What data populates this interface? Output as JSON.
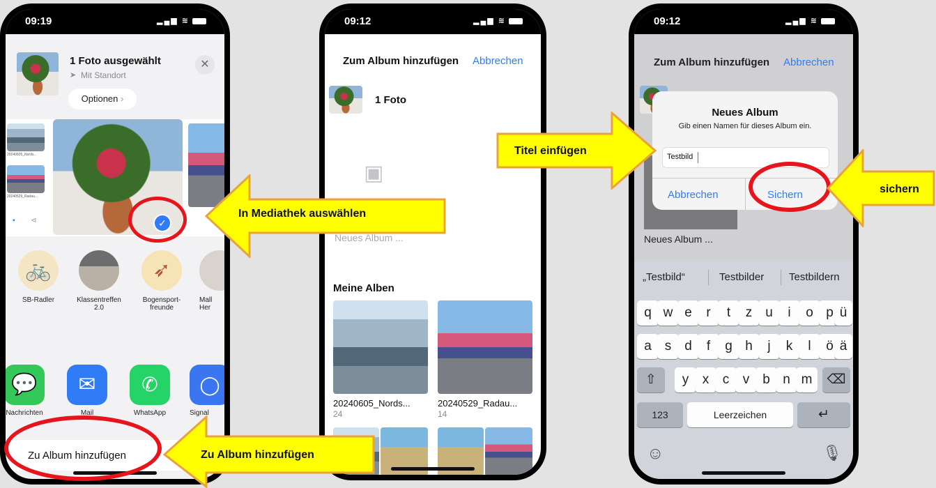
{
  "phone1": {
    "time": "09:19",
    "share_title": "1 Foto ausgewählt",
    "share_subtitle": "Mit Standort",
    "options_label": "Optionen",
    "thumb_small_label_1": "20240605_Nords...",
    "thumb_small_label_2": "20240529_Radau...",
    "contacts": [
      {
        "name": "SB-Radler"
      },
      {
        "name": "Klassentreffen\n2.0"
      },
      {
        "name": "Bogensport-\nfreunde"
      },
      {
        "name": "Mall\nHer"
      }
    ],
    "apps": [
      {
        "name": "Nachrichten"
      },
      {
        "name": "Mail"
      },
      {
        "name": "WhatsApp"
      },
      {
        "name": "Signal"
      }
    ],
    "add_to_album": "Zu Album hinzufügen"
  },
  "phone2": {
    "time": "09:12",
    "title": "Zum Album hinzufügen",
    "cancel": "Abbrechen",
    "photo_count": "1 Foto",
    "new_album_placeholder": "Neues Album ...",
    "section_title": "Meine Alben",
    "albums": [
      {
        "name": "20240605_Nords...",
        "count": "24"
      },
      {
        "name": "20240529_Radau...",
        "count": "14"
      }
    ]
  },
  "phone3": {
    "time": "09:12",
    "title": "Zum Album hinzufügen",
    "cancel": "Abbrechen",
    "dialog_title": "Neues Album",
    "dialog_message": "Gib einen Namen für dieses Album ein.",
    "input_value": "Testbild",
    "dialog_cancel": "Abbrechen",
    "dialog_save": "Sichern",
    "new_album_label": "Neues Album ...",
    "suggestions": [
      "„Testbild“",
      "Testbilder",
      "Testbildern"
    ],
    "row1": [
      "q",
      "w",
      "e",
      "r",
      "t",
      "z",
      "u",
      "i",
      "o",
      "p",
      "ü"
    ],
    "row2": [
      "a",
      "s",
      "d",
      "f",
      "g",
      "h",
      "j",
      "k",
      "l",
      "ö",
      "ä"
    ],
    "row3": [
      "y",
      "x",
      "c",
      "v",
      "b",
      "n",
      "m"
    ],
    "numbers_key": "123",
    "space_key": "Leerzeichen"
  },
  "callouts": {
    "select_library": "In Mediathek auswählen",
    "add_album": "Zu Album hinzufügen",
    "insert_title": "Titel einfügen",
    "save": "sichern"
  },
  "colors": {
    "ios_blue": "#2f7cf6",
    "callout_fill": "#ffff00",
    "callout_border": "#e8a33a",
    "highlight_ring": "#e8141c",
    "whatsapp_green": "#25d366"
  }
}
